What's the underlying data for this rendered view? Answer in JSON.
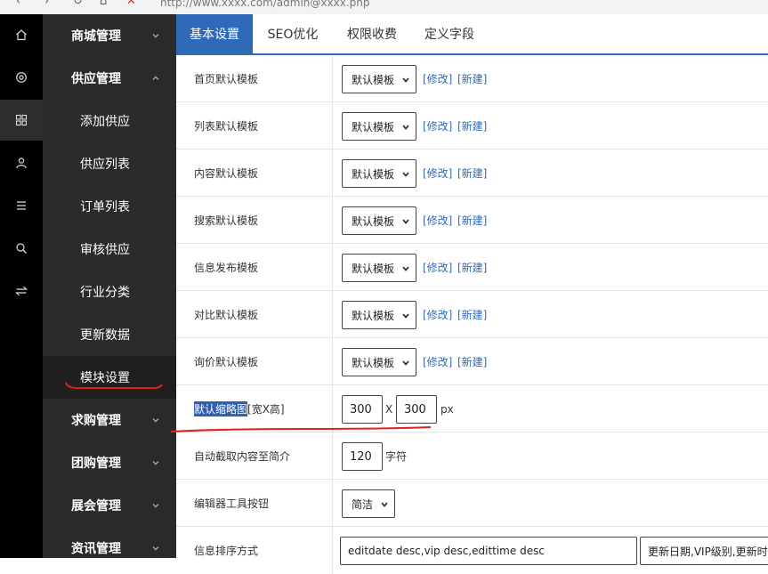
{
  "browser": {
    "address": "http://www.xxxx.com/admin@xxxx.php"
  },
  "rail": {
    "icons": [
      "home-icon",
      "settings-icon",
      "grid-icon",
      "user-icon",
      "list-icon",
      "search-icon",
      "swap-icon"
    ]
  },
  "menu": {
    "groups": [
      {
        "label": "商城管理"
      },
      {
        "label": "供应管理"
      },
      {
        "label": "求购管理"
      },
      {
        "label": "团购管理"
      },
      {
        "label": "展会管理"
      },
      {
        "label": "资讯管理"
      }
    ],
    "sub": [
      {
        "label": "添加供应"
      },
      {
        "label": "供应列表"
      },
      {
        "label": "订单列表"
      },
      {
        "label": "审核供应"
      },
      {
        "label": "行业分类"
      },
      {
        "label": "更新数据"
      },
      {
        "label": "模块设置"
      }
    ]
  },
  "tabs": [
    {
      "label": "基本设置"
    },
    {
      "label": "SEO优化"
    },
    {
      "label": "权限收费"
    },
    {
      "label": "定义字段"
    }
  ],
  "form": {
    "template_rows": [
      {
        "label": "首页默认模板",
        "value": "默认模板"
      },
      {
        "label": "列表默认模板",
        "value": "默认模板"
      },
      {
        "label": "内容默认模板",
        "value": "默认模板"
      },
      {
        "label": "搜索默认模板",
        "value": "默认模板"
      },
      {
        "label": "信息发布模板",
        "value": "默认模板"
      },
      {
        "label": "对比默认模板",
        "value": "默认模板"
      },
      {
        "label": "询价默认模板",
        "value": "默认模板"
      }
    ],
    "edit_link": "[修改]",
    "new_link": "[新建]",
    "thumb": {
      "label_hl": "默认缩略图",
      "label_rest": "[宽X高]",
      "width": "300",
      "sep": "X",
      "height": "300",
      "unit": "px"
    },
    "intro": {
      "label": "自动截取内容至简介",
      "value": "120",
      "unit": "字符"
    },
    "editor": {
      "label": "编辑器工具按钮",
      "value": "简洁"
    },
    "order": {
      "label": "信息排序方式",
      "value": "editdate desc,vip desc,edittime desc",
      "select": "更新日期,VIP级别,更新时"
    }
  },
  "colors": {
    "accent": "#2f6ab9",
    "annotation": "#e02020",
    "sidebar": "#2b2b2b",
    "rail": "#000000"
  }
}
